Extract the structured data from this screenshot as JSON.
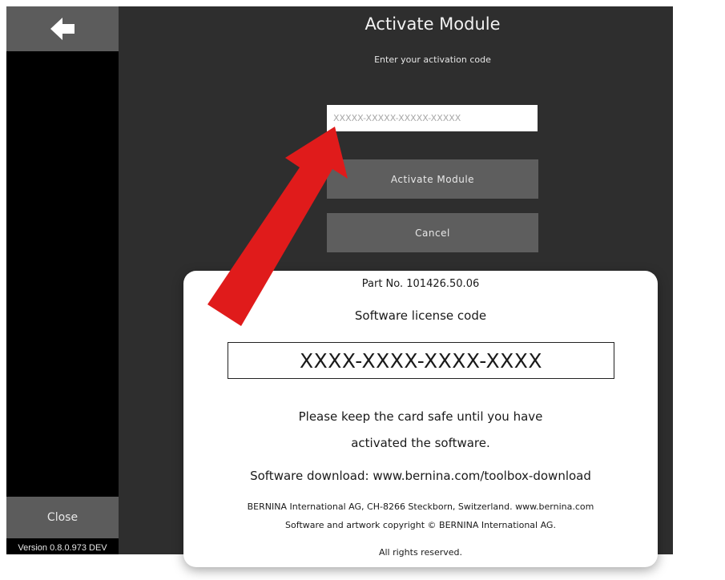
{
  "sidebar": {
    "back_icon": "arrow-left-icon",
    "close_label": "Close",
    "version": "Version 0.8.0.973 DEV"
  },
  "dialog": {
    "title": "Activate Module",
    "subtitle": "Enter your activation code",
    "code_placeholder": "XXXXX-XXXXX-XXXXX-XXXXX",
    "code_value": "",
    "activate_label": "Activate Module",
    "cancel_label": "Cancel"
  },
  "card": {
    "part_no": "Part No. 101426.50.06",
    "license_label": "Software license code",
    "license_code": "XXXX-XXXX-XXXX-XXXX",
    "keep_line1": "Please keep the card safe until you have",
    "keep_line2": "activated the software.",
    "download": "Software download: www.bernina.com/toolbox-download",
    "company": "BERNINA International AG, CH-8266 Steckborn, Switzerland. www.bernina.com",
    "copyright": "Software and artwork copyright © BERNINA International AG.",
    "rights": "All rights reserved."
  },
  "colors": {
    "app_bg": "#2e2e2e",
    "sidebar_bg": "#000000",
    "button_bg": "#5e5e5e",
    "arrow": "#e01b1b"
  }
}
